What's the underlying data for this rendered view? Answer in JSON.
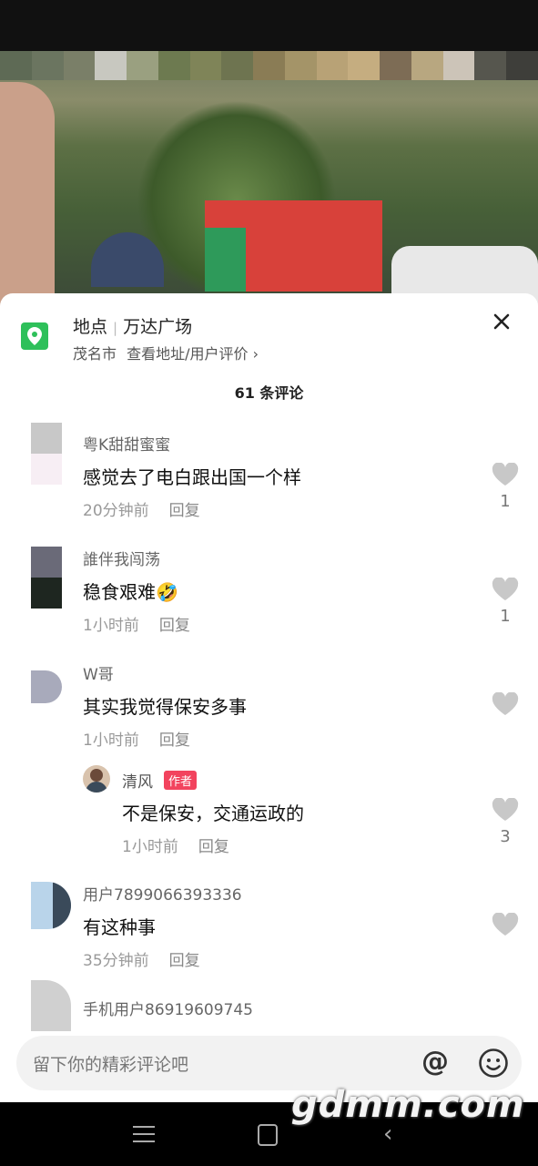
{
  "location": {
    "label": "地点",
    "name": "万达广场",
    "city": "茂名市",
    "detail_link": "查看地址/用户评价",
    "detail_chevron": "›"
  },
  "comments_count": "61 条评论",
  "comments": [
    {
      "user": "粤K甜甜蜜蜜",
      "text": "感觉去了电白跟出国一个样",
      "time": "20分钟前",
      "reply_label": "回复",
      "likes": "1"
    },
    {
      "user": "誰伴我闯荡",
      "text": "稳食艰难🤣",
      "time": "1小时前",
      "reply_label": "回复",
      "likes": "1"
    },
    {
      "user": "W哥",
      "text": "其实我觉得保安多事",
      "time": "1小时前",
      "reply_label": "回复",
      "likes": ""
    },
    {
      "user": "用户7899066393336",
      "text": "有这种事",
      "time": "35分钟前",
      "reply_label": "回复",
      "likes": ""
    },
    {
      "user": "手机用户86919609745",
      "text": "",
      "time": "",
      "reply_label": "",
      "likes": ""
    }
  ],
  "reply": {
    "user": "清风",
    "badge": "作者",
    "text": "不是保安，交通运政的",
    "time": "1小时前",
    "reply_label": "回复",
    "likes": "3"
  },
  "input": {
    "placeholder": "留下你的精彩评论吧",
    "at_symbol": "@"
  },
  "watermark": "gdmm.com",
  "colors": {
    "location_icon": "#2ec05a",
    "author_badge": "#f2435e",
    "like_heart": "#c8c8c8"
  }
}
